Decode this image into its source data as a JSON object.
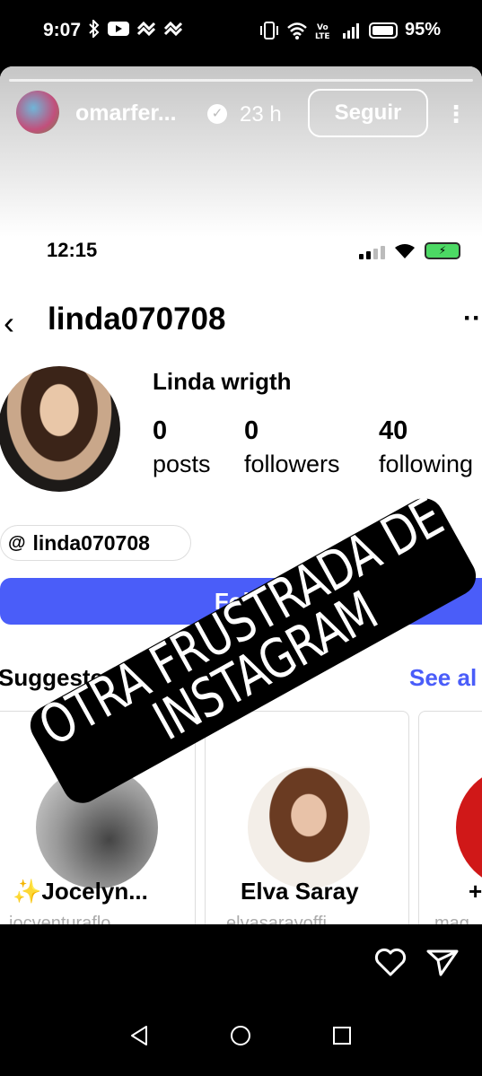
{
  "android_status": {
    "time": "9:07",
    "battery": "95%",
    "left_icons": [
      "bluetooth-icon",
      "youtube-icon",
      "app-icon",
      "app-icon"
    ],
    "right_icons": [
      "vibrate-icon",
      "wifi-icon",
      "volte-icon",
      "signal-icon",
      "battery-icon"
    ]
  },
  "story": {
    "username": "omarfer...",
    "time_ago": "23 h",
    "follow_label": "Seguir",
    "more_icon": "more-vertical-icon"
  },
  "screenshot": {
    "ios_time": "12:15",
    "handle": "linda070708",
    "display_name": "Linda wrigth",
    "stats": [
      {
        "num": "0",
        "label": "posts"
      },
      {
        "num": "0",
        "label": "followers"
      },
      {
        "num": "40",
        "label": "following"
      }
    ],
    "threads_handle": "linda070708",
    "follow_button": "Follow",
    "suggested_label": "Suggested fo",
    "see_all": "See al",
    "suggestions": [
      {
        "name": "✨Jocelyn...",
        "sub": "jocventuraflo..."
      },
      {
        "name": "Elva Saray",
        "sub": "elvasarayoffi..."
      },
      {
        "name": "+",
        "sub": "mag..."
      }
    ]
  },
  "sticker": {
    "line1": "OTRA FRUSTRADA DE",
    "line2": "INSTAGRAM"
  },
  "colors": {
    "follow_blue": "#4a5df9",
    "background": "#000000"
  }
}
